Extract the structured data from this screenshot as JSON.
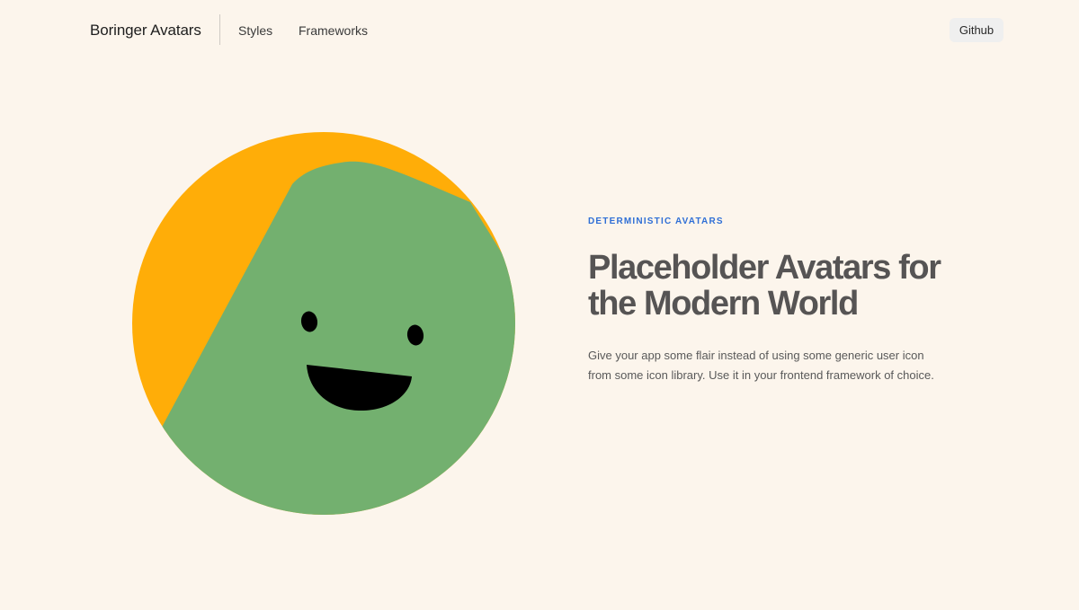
{
  "nav": {
    "brand": "Boringer Avatars",
    "links": [
      "Styles",
      "Frameworks"
    ],
    "github_label": "Github"
  },
  "hero": {
    "eyebrow": "DETERMINISTIC AVATARS",
    "title": "Placeholder Avatars for the Modern World",
    "body": "Give your app some flair instead of using some generic user icon from some icon library. Use it in your frontend framework of choice."
  },
  "colors": {
    "background": "#fcf5ec",
    "avatar_background": "#ffad08",
    "avatar_face": "#73b06f",
    "avatar_features": "#000000",
    "eyebrow": "#2f6fd6",
    "title": "#565454"
  }
}
